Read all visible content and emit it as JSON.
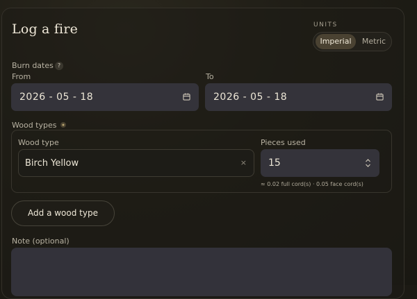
{
  "form": {
    "title": "Log a fire"
  },
  "units": {
    "label": "UNITS",
    "options": [
      "Imperial",
      "Metric"
    ],
    "selected": "Imperial"
  },
  "burn_dates": {
    "label": "Burn dates",
    "help": "?",
    "from_label": "From",
    "from_value": "2026 - 05 - 18",
    "to_label": "To",
    "to_value": "2026 - 05 - 18"
  },
  "wood_types": {
    "label": "Wood types",
    "entries": [
      {
        "wood_type_label": "Wood type",
        "wood_type_value": "Birch Yellow",
        "clear": "×",
        "pieces_label": "Pieces used",
        "pieces_value": "15",
        "cords_text": "≈ 0.02 full cord(s) · 0.05 face cord(s)"
      }
    ],
    "add_button": "Add a wood type"
  },
  "note": {
    "label": "Note (optional)",
    "value": ""
  },
  "colors": {
    "background": "#1c1a14",
    "field": "#34333a",
    "accent": "#4a4232"
  }
}
